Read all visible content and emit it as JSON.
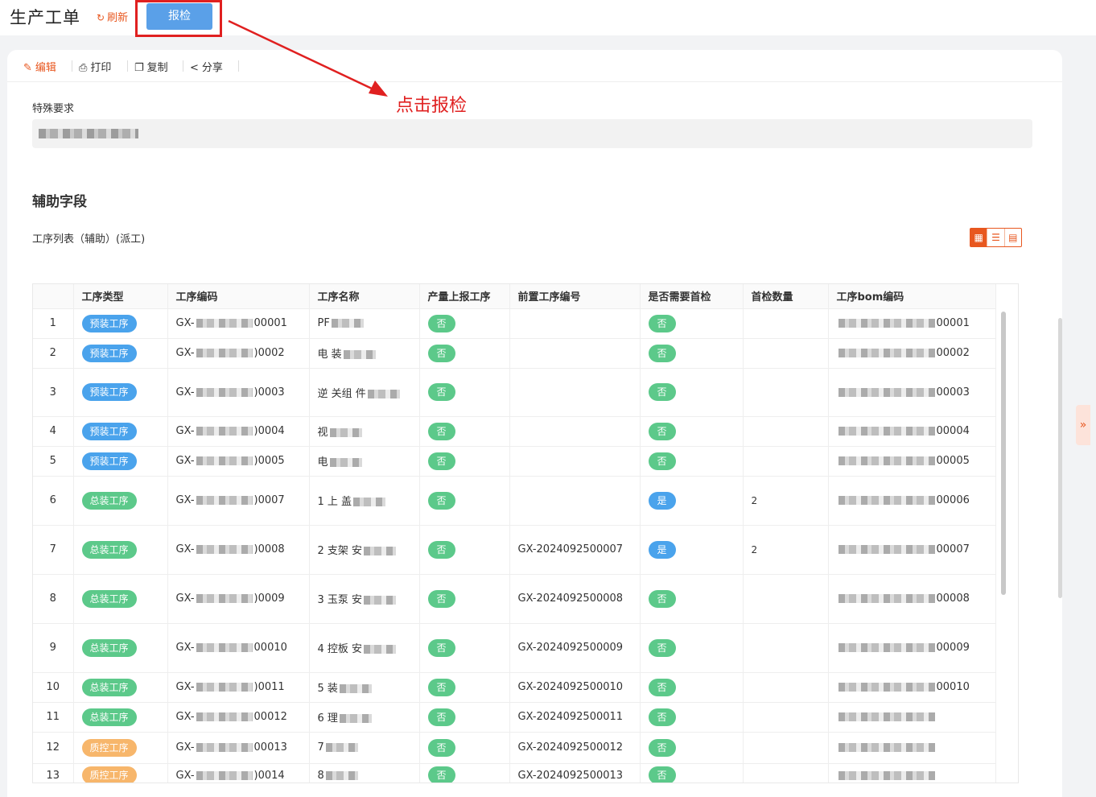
{
  "header": {
    "title": "生产工单",
    "refresh_label": "刷新",
    "report_label": "报检"
  },
  "annotation": {
    "text": "点击报检"
  },
  "toolbar": {
    "edit": "编辑",
    "print": "打印",
    "copy": "复制",
    "share": "分享"
  },
  "special": {
    "label": "特殊要求"
  },
  "section": {
    "title": "辅助字段",
    "sub_label": "工序列表（辅助）(派工)"
  },
  "colors": {
    "accent": "#e8571f",
    "primary": "#5aa0e8",
    "annotation": "#e02020",
    "tag_pre": "#4aa3ec",
    "tag_asm": "#5cc98a",
    "tag_qc": "#f7b66b"
  },
  "table": {
    "headers": [
      "",
      "工序类型",
      "工序编码",
      "工序名称",
      "产量上报工序",
      "前置工序编号",
      "是否需要首检",
      "首检数量",
      "工序bom编码"
    ],
    "rows": [
      {
        "idx": "1",
        "type": "预装工序",
        "code_pre": "GX-",
        "code_suf": "00001",
        "name": "PF",
        "report": "否",
        "prev": "",
        "first": "否",
        "qty": "",
        "bom": "00001"
      },
      {
        "idx": "2",
        "type": "预装工序",
        "code_pre": "GX-",
        "code_suf": ")0002",
        "name": "电 装",
        "report": "否",
        "prev": "",
        "first": "否",
        "qty": "",
        "bom": "00002"
      },
      {
        "idx": "3",
        "type": "预装工序",
        "code_pre": "GX-",
        "code_suf": ")0003",
        "name": "逆 关组 件",
        "report": "否",
        "prev": "",
        "first": "否",
        "qty": "",
        "bom": "00003"
      },
      {
        "idx": "4",
        "type": "预装工序",
        "code_pre": "GX-",
        "code_suf": ")0004",
        "name": "视",
        "report": "否",
        "prev": "",
        "first": "否",
        "qty": "",
        "bom": "00004"
      },
      {
        "idx": "5",
        "type": "预装工序",
        "code_pre": "GX-",
        "code_suf": ")0005",
        "name": "电",
        "report": "否",
        "prev": "",
        "first": "否",
        "qty": "",
        "bom": "00005"
      },
      {
        "idx": "6",
        "type": "总装工序",
        "code_pre": "GX-",
        "code_suf": ")0007",
        "name": "1 上 盖",
        "report": "否",
        "prev": "",
        "first": "是",
        "qty": "2",
        "bom": "00006"
      },
      {
        "idx": "7",
        "type": "总装工序",
        "code_pre": "GX-",
        "code_suf": ")0008",
        "name": "2 支架 安",
        "report": "否",
        "prev": "GX-2024092500007",
        "first": "是",
        "qty": "2",
        "bom": "00007"
      },
      {
        "idx": "8",
        "type": "总装工序",
        "code_pre": "GX-",
        "code_suf": ")0009",
        "name": "3 玉泵 安",
        "report": "否",
        "prev": "GX-2024092500008",
        "first": "否",
        "qty": "",
        "bom": "00008"
      },
      {
        "idx": "9",
        "type": "总装工序",
        "code_pre": "GX-",
        "code_suf": "00010",
        "name": "4 控板 安",
        "report": "否",
        "prev": "GX-2024092500009",
        "first": "否",
        "qty": "",
        "bom": "00009"
      },
      {
        "idx": "10",
        "type": "总装工序",
        "code_pre": "GX-",
        "code_suf": ")0011",
        "name": "5 装",
        "report": "否",
        "prev": "GX-2024092500010",
        "first": "否",
        "qty": "",
        "bom": "00010"
      },
      {
        "idx": "11",
        "type": "总装工序",
        "code_pre": "GX-",
        "code_suf": "00012",
        "name": "6 理",
        "report": "否",
        "prev": "GX-2024092500011",
        "first": "否",
        "qty": "",
        "bom": ""
      },
      {
        "idx": "12",
        "type": "质控工序",
        "code_pre": "GX-",
        "code_suf": "00013",
        "name": "7",
        "report": "否",
        "prev": "GX-2024092500012",
        "first": "否",
        "qty": "",
        "bom": ""
      },
      {
        "idx": "13",
        "type": "质控工序",
        "code_pre": "GX-",
        "code_suf": ")0014",
        "name": "8",
        "report": "否",
        "prev": "GX-2024092500013",
        "first": "否",
        "qty": "",
        "bom": ""
      }
    ]
  }
}
